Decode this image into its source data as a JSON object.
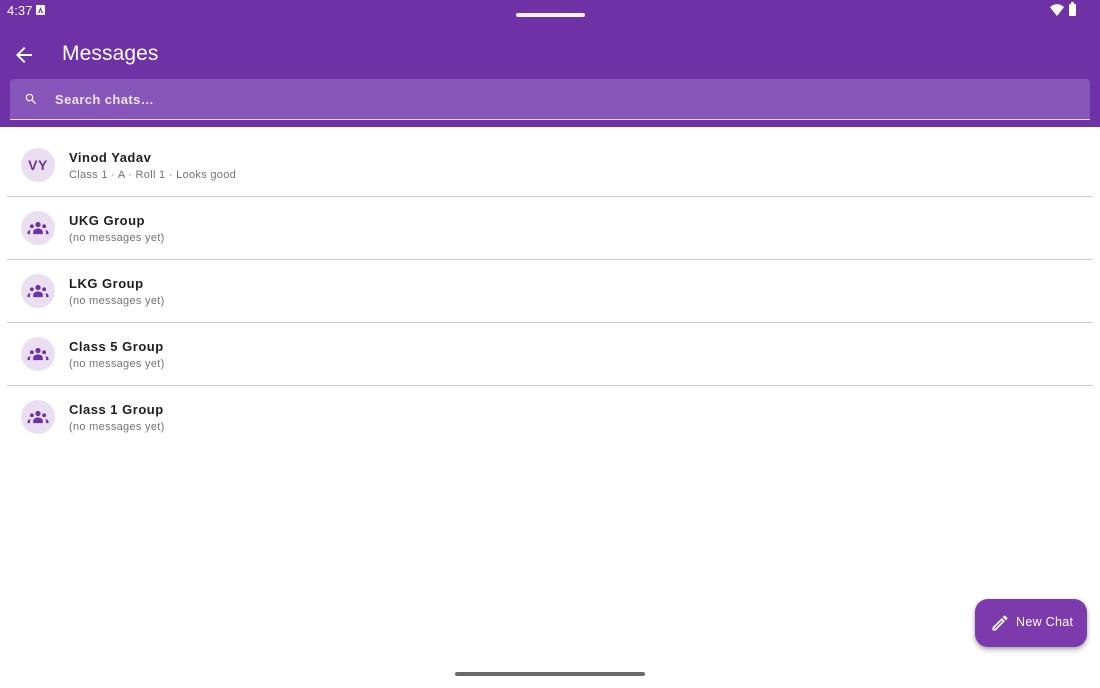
{
  "status_bar": {
    "time": "4:37",
    "notification_icon": "notification-a-icon",
    "wifi_icon": "wifi-icon",
    "battery_icon": "battery-icon"
  },
  "header": {
    "back_icon": "arrow-back-icon",
    "title": "Messages",
    "background_color": "#6f32a6"
  },
  "search": {
    "icon": "search-icon",
    "placeholder": "Search chats…",
    "value": ""
  },
  "chats": [
    {
      "type": "person",
      "initials": "VY",
      "name": "Vinod Yadav",
      "preview": "Class 1 · A · Roll 1 · Looks good"
    },
    {
      "type": "group",
      "icon": "group-icon",
      "name": "UKG Group",
      "preview": "(no messages yet)"
    },
    {
      "type": "group",
      "icon": "group-icon",
      "name": "LKG Group",
      "preview": "(no messages yet)"
    },
    {
      "type": "group",
      "icon": "group-icon",
      "name": "Class 5 Group",
      "preview": "(no messages yet)"
    },
    {
      "type": "group",
      "icon": "group-icon",
      "name": "Class 1 Group",
      "preview": "(no messages yet)"
    }
  ],
  "fab": {
    "icon": "edit-pencil-icon",
    "label": "New Chat",
    "color": "#7c3aad"
  }
}
